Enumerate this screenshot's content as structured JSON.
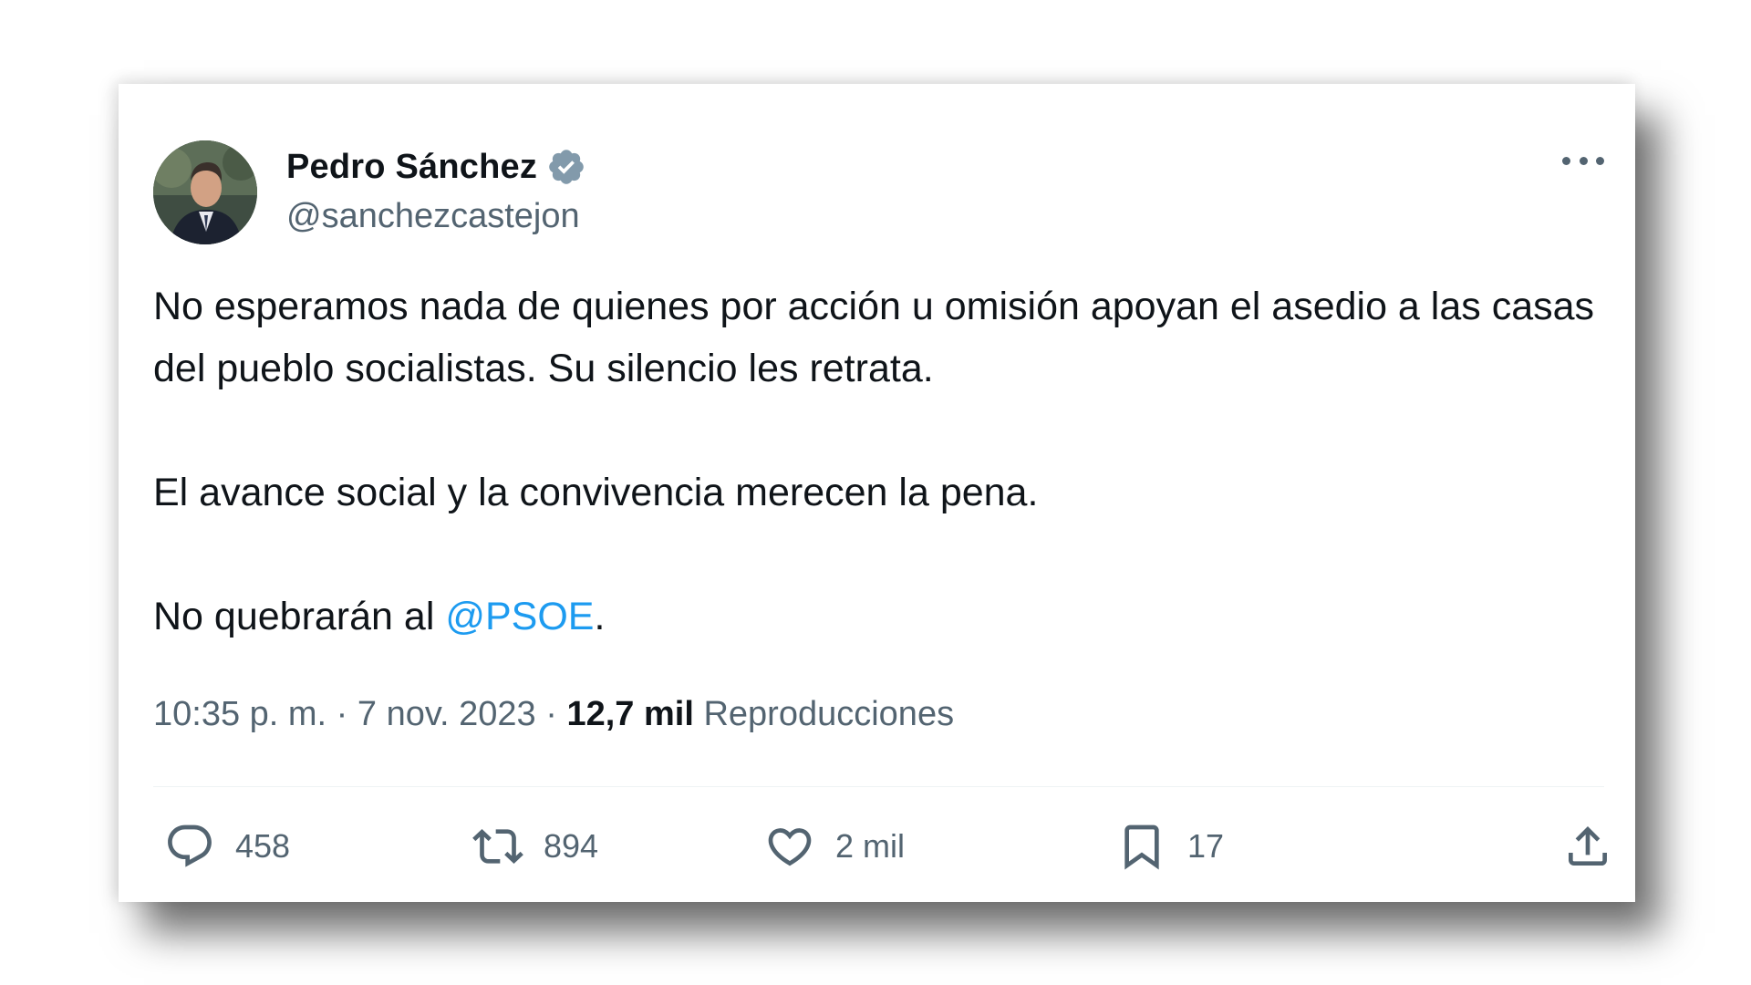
{
  "author": {
    "display_name": "Pedro Sánchez",
    "handle": "@sanchezcastejon",
    "verified_icon": "verified-badge-icon"
  },
  "tweet": {
    "paragraph1": "No esperamos nada de quienes por acción u omisión apoyan el asedio a las casas del pueblo socialistas. Su silencio les retrata.",
    "paragraph2": "El avance social y la convivencia merecen la pena.",
    "paragraph3_prefix": "No quebrarán al ",
    "mention": "@PSOE",
    "paragraph3_suffix": "."
  },
  "meta": {
    "time": "10:35 p. m.",
    "separator1": " · ",
    "date": "7 nov. 2023",
    "separator2": " · ",
    "views_count": "12,7 mil",
    "views_label": " Reproducciones"
  },
  "actions": {
    "reply_count": "458",
    "retweet_count": "894",
    "like_count": "2 mil",
    "bookmark_count": "17"
  },
  "colors": {
    "text": "#0f1419",
    "secondary": "#536471",
    "accent": "#1d9bf0"
  }
}
